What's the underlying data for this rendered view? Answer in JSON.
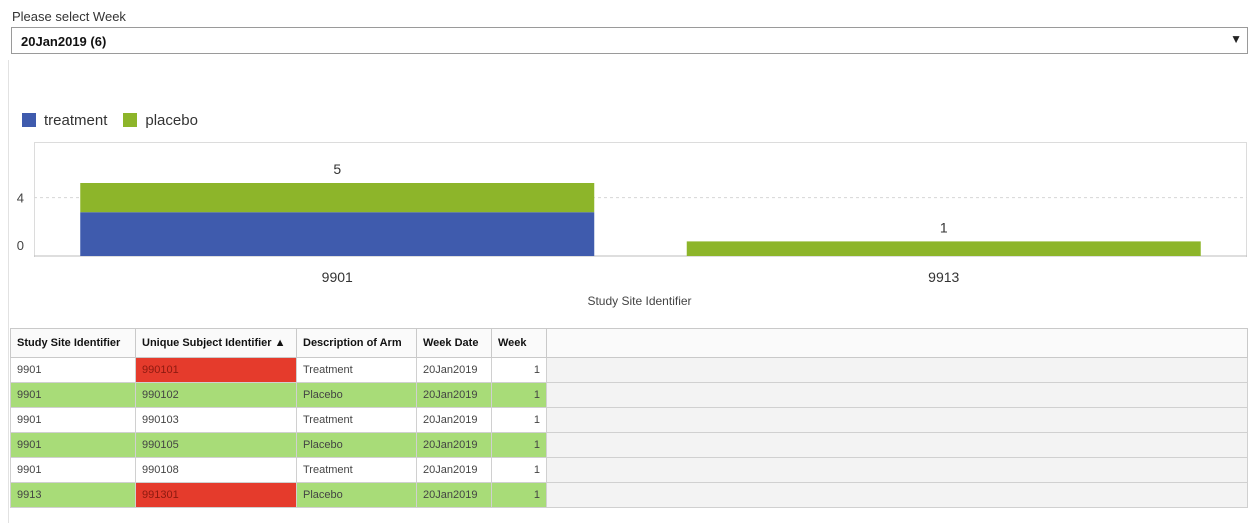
{
  "week_select": {
    "label": "Please select Week",
    "selected": "20Jan2019 (6)"
  },
  "colors": {
    "treatment": "#3f5bad",
    "placebo": "#8db52a",
    "row_highlight": "#a8dc78",
    "alert": "#e53b2c"
  },
  "chart_data": {
    "type": "bar",
    "stacked": true,
    "categories": [
      "9901",
      "9913"
    ],
    "series": [
      {
        "name": "treatment",
        "values": [
          3,
          0
        ]
      },
      {
        "name": "placebo",
        "values": [
          2,
          1
        ]
      }
    ],
    "totals": [
      5,
      1
    ],
    "yticks": [
      0,
      4
    ],
    "xlabel": "Study Site Identifier",
    "legend": "top-left",
    "grid": true
  },
  "table": {
    "columns": [
      "Study Site Identifier",
      "Unique Subject Identifier ▲",
      "Description of Arm",
      "Week Date",
      "Week"
    ],
    "rows": [
      {
        "site": "9901",
        "subject": "990101",
        "arm": "Treatment",
        "date": "20Jan2019",
        "week": "1",
        "alert": true
      },
      {
        "site": "9901",
        "subject": "990102",
        "arm": "Placebo",
        "date": "20Jan2019",
        "week": "1",
        "alert": false
      },
      {
        "site": "9901",
        "subject": "990103",
        "arm": "Treatment",
        "date": "20Jan2019",
        "week": "1",
        "alert": false
      },
      {
        "site": "9901",
        "subject": "990105",
        "arm": "Placebo",
        "date": "20Jan2019",
        "week": "1",
        "alert": false
      },
      {
        "site": "9901",
        "subject": "990108",
        "arm": "Treatment",
        "date": "20Jan2019",
        "week": "1",
        "alert": false
      },
      {
        "site": "9913",
        "subject": "991301",
        "arm": "Placebo",
        "date": "20Jan2019",
        "week": "1",
        "alert": true
      }
    ]
  }
}
